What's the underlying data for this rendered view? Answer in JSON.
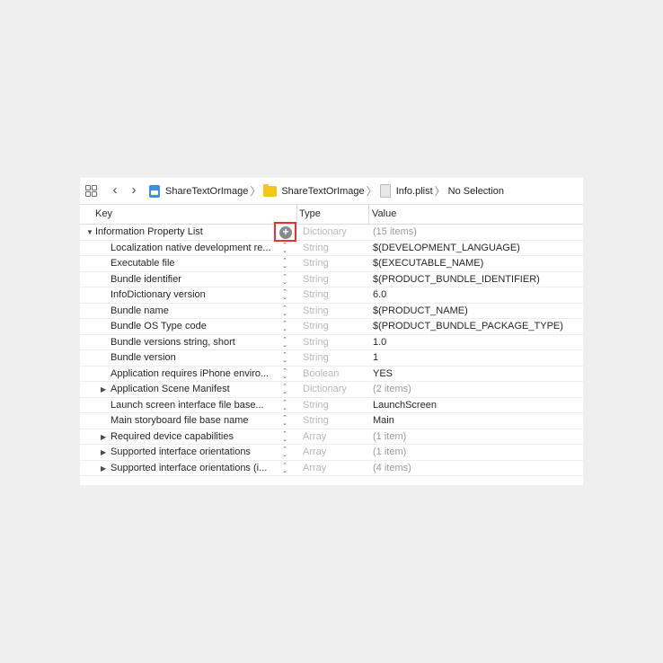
{
  "breadcrumb": {
    "project": "ShareTextOrImage",
    "folder": "ShareTextOrImage",
    "file": "Info.plist",
    "selection": "No Selection"
  },
  "columns": {
    "key": "Key",
    "type": "Type",
    "value": "Value"
  },
  "rows": [
    {
      "key": "Information Property List",
      "type": "Dictionary",
      "value": "(15 items)",
      "expander": "expanded",
      "root": true
    },
    {
      "key": "Localization native development re...",
      "type": "String",
      "value": "$(DEVELOPMENT_LANGUAGE)"
    },
    {
      "key": "Executable file",
      "type": "String",
      "value": "$(EXECUTABLE_NAME)"
    },
    {
      "key": "Bundle identifier",
      "type": "String",
      "value": "$(PRODUCT_BUNDLE_IDENTIFIER)"
    },
    {
      "key": "InfoDictionary version",
      "type": "String",
      "value": "6.0"
    },
    {
      "key": "Bundle name",
      "type": "String",
      "value": "$(PRODUCT_NAME)"
    },
    {
      "key": "Bundle OS Type code",
      "type": "String",
      "value": "$(PRODUCT_BUNDLE_PACKAGE_TYPE)"
    },
    {
      "key": "Bundle versions string, short",
      "type": "String",
      "value": "1.0"
    },
    {
      "key": "Bundle version",
      "type": "String",
      "value": "1"
    },
    {
      "key": "Application requires iPhone enviro...",
      "type": "Boolean",
      "value": "YES"
    },
    {
      "key": "Application Scene Manifest",
      "type": "Dictionary",
      "value": "(2 items)",
      "expander": "collapsed"
    },
    {
      "key": "Launch screen interface file base...",
      "type": "String",
      "value": "LaunchScreen"
    },
    {
      "key": "Main storyboard file base name",
      "type": "String",
      "value": "Main"
    },
    {
      "key": "Required device capabilities",
      "type": "Array",
      "value": "(1 item)",
      "expander": "collapsed"
    },
    {
      "key": "Supported interface orientations",
      "type": "Array",
      "value": "(1 item)",
      "expander": "collapsed"
    },
    {
      "key": "Supported interface orientations (i...",
      "type": "Array",
      "value": "(4 items)",
      "expander": "collapsed"
    }
  ],
  "icons": {
    "grid": "grid-icon",
    "back": "chevron-left-icon",
    "forward": "chevron-right-icon",
    "project": "xcode-project-icon",
    "folder": "folder-icon",
    "plist": "plist-file-icon",
    "add": "add-circle-icon",
    "stepper": "stepper-icon"
  },
  "colors": {
    "highlight": "#e8322b",
    "folder": "#f5c518",
    "project": "#3b8fe8"
  }
}
